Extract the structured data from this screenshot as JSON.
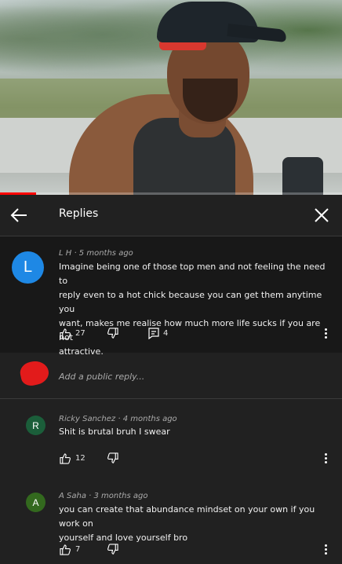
{
  "video": {
    "progress_fraction": 0.105
  },
  "header": {
    "title": "Replies"
  },
  "top_comment": {
    "avatar_letter": "L",
    "avatar_color": "#1e88e5",
    "meta": "L H · 5 months ago",
    "lines": [
      "Imagine being one of those top men and not feeling the need to",
      "reply even to a hot chick because you can get them anytime you",
      "want, makes me realise how much more life sucks if you are not",
      "attractive."
    ],
    "likes": "27",
    "replies": "4"
  },
  "add_reply": {
    "placeholder": "Add a public reply..."
  },
  "replies": [
    {
      "avatar_letter": "R",
      "avatar_color": "#1b5e3a",
      "meta": "Ricky Sanchez · 4 months ago",
      "lines": [
        "Shit is brutal bruh I swear"
      ],
      "likes": "12"
    },
    {
      "avatar_letter": "A",
      "avatar_color": "#33691e",
      "meta": "A Saha · 3 months ago",
      "lines": [
        "you can create that abundance mindset on your own if you work on",
        "yourself and love yourself bro"
      ],
      "likes": "7"
    }
  ],
  "icons": {
    "back": "arrow-left-icon",
    "close": "close-icon",
    "like": "thumbs-up-icon",
    "dislike": "thumbs-down-icon",
    "reply": "comment-icon",
    "more": "more-vert-icon"
  }
}
